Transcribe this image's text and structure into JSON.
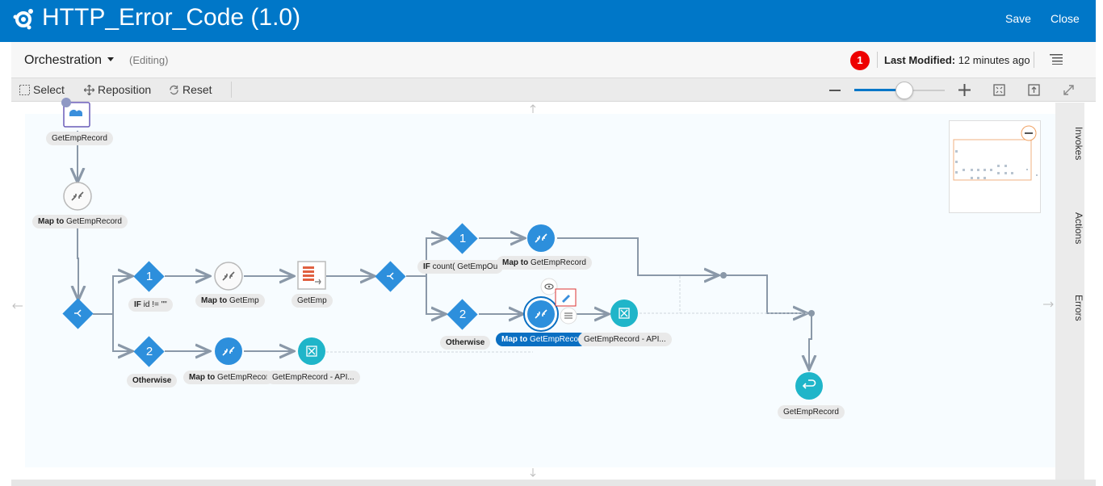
{
  "header": {
    "title": "HTTP_Error_Code (1.0)",
    "save_label": "Save",
    "close_label": "Close"
  },
  "subheader": {
    "mode": "Orchestration",
    "editing": "(Editing)",
    "badge_count": "1",
    "last_modified_label": "Last Modified:",
    "last_modified_value": " 12 minutes ago"
  },
  "toolbar": {
    "select_label": "Select",
    "reposition_label": "Reposition",
    "reset_label": "Reset"
  },
  "right_tabs": {
    "invokes": "Invokes",
    "actions": "Actions",
    "errors": "Errors"
  },
  "flow": {
    "get_emp_record_top": "GetEmpRecord",
    "map_top_bold": "Map to",
    "map_top_rest": " GetEmpRecord",
    "branch1_num": "1",
    "branch1_cond_bold": "IF",
    "branch1_cond_rest": " id != \"\"",
    "map_getemp_bold": "Map to",
    "map_getemp_rest": " GetEmp",
    "getemp_invoke": "GetEmp",
    "branch2_num": "2",
    "otherwise1": "Otherwise",
    "map2_bold": "Map to",
    "map2_rest": " GetEmpRecor",
    "api1": "GetEmpRecord - API...",
    "inner1_num": "1",
    "inner_cond_bold": "IF",
    "inner_cond_rest": " count( GetEmpOu",
    "map3_bold": "Map to",
    "map3_rest": " GetEmpRecord",
    "inner2_num": "2",
    "otherwise2": "Otherwise",
    "map4_bold": "Map to",
    "map4_rest": " GetEmpRecor",
    "api2": "GetEmpRecord - API...",
    "return_label": "GetEmpRecord"
  },
  "colors": {
    "brand_blue": "#0077c8",
    "node_blue": "#2d8fdc",
    "teal": "#1fb5c9",
    "badge_red": "#e00000"
  }
}
